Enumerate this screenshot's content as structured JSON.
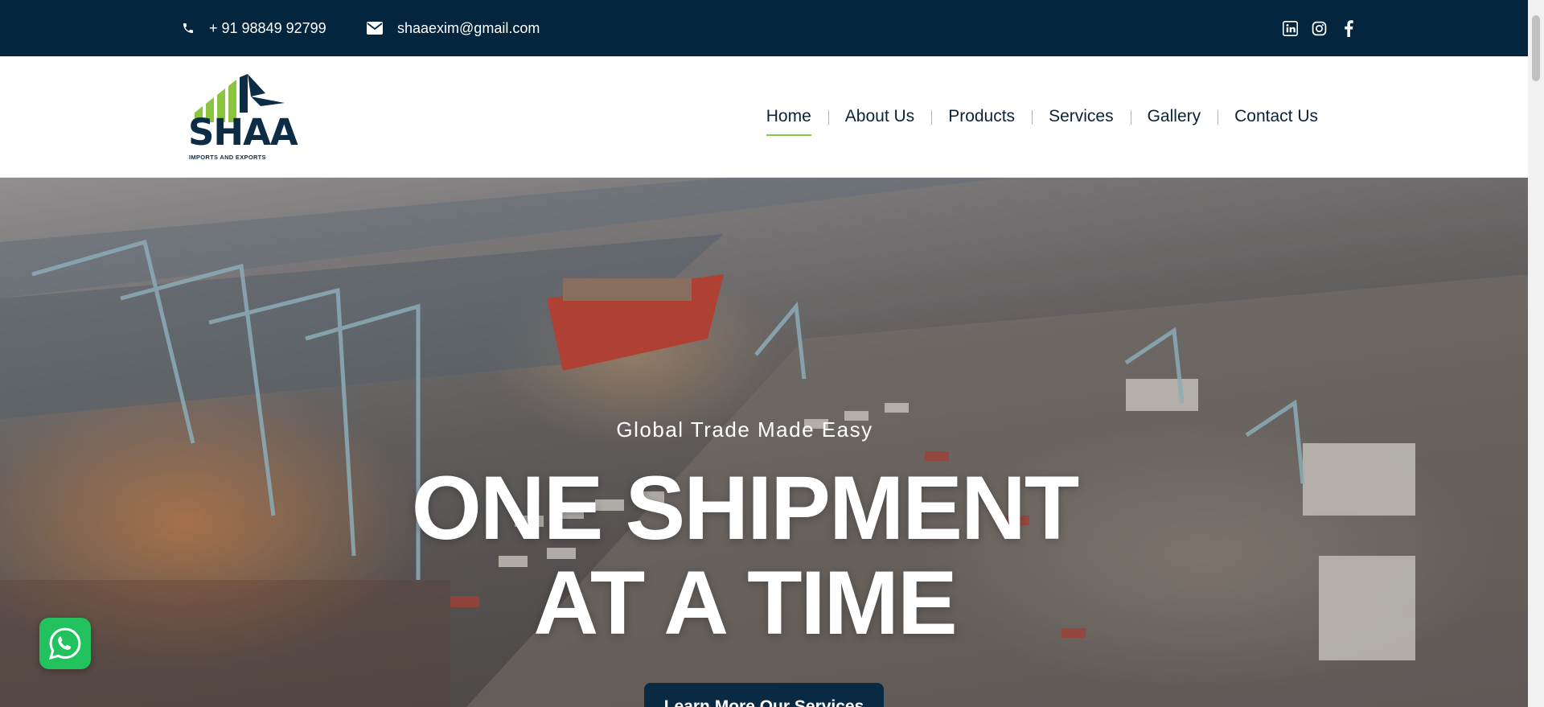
{
  "topbar": {
    "phone": "+ 91 98849 92799",
    "email": "shaaexim@gmail.com",
    "social": [
      {
        "name": "linkedin-icon"
      },
      {
        "name": "instagram-icon"
      },
      {
        "name": "facebook-icon"
      }
    ],
    "background": "#03253d"
  },
  "logo": {
    "text": "SHAA",
    "subtitle": "IMPORTS AND EXPORTS",
    "accent": "#8bc53f",
    "navy": "#0d2c45"
  },
  "nav": {
    "items": [
      {
        "label": "Home",
        "active": true
      },
      {
        "label": "About Us"
      },
      {
        "label": "Products"
      },
      {
        "label": "Services"
      },
      {
        "label": "Gallery"
      },
      {
        "label": "Contact Us"
      }
    ]
  },
  "hero": {
    "eyebrow": "Global Trade Made Easy",
    "title_line1": "ONE SHIPMENT",
    "title_line2": "AT A TIME",
    "cta": "Learn More Our Services",
    "image": "aerial-container-port"
  },
  "whatsapp": {
    "icon": "whatsapp-icon",
    "color": "#22c35e"
  }
}
